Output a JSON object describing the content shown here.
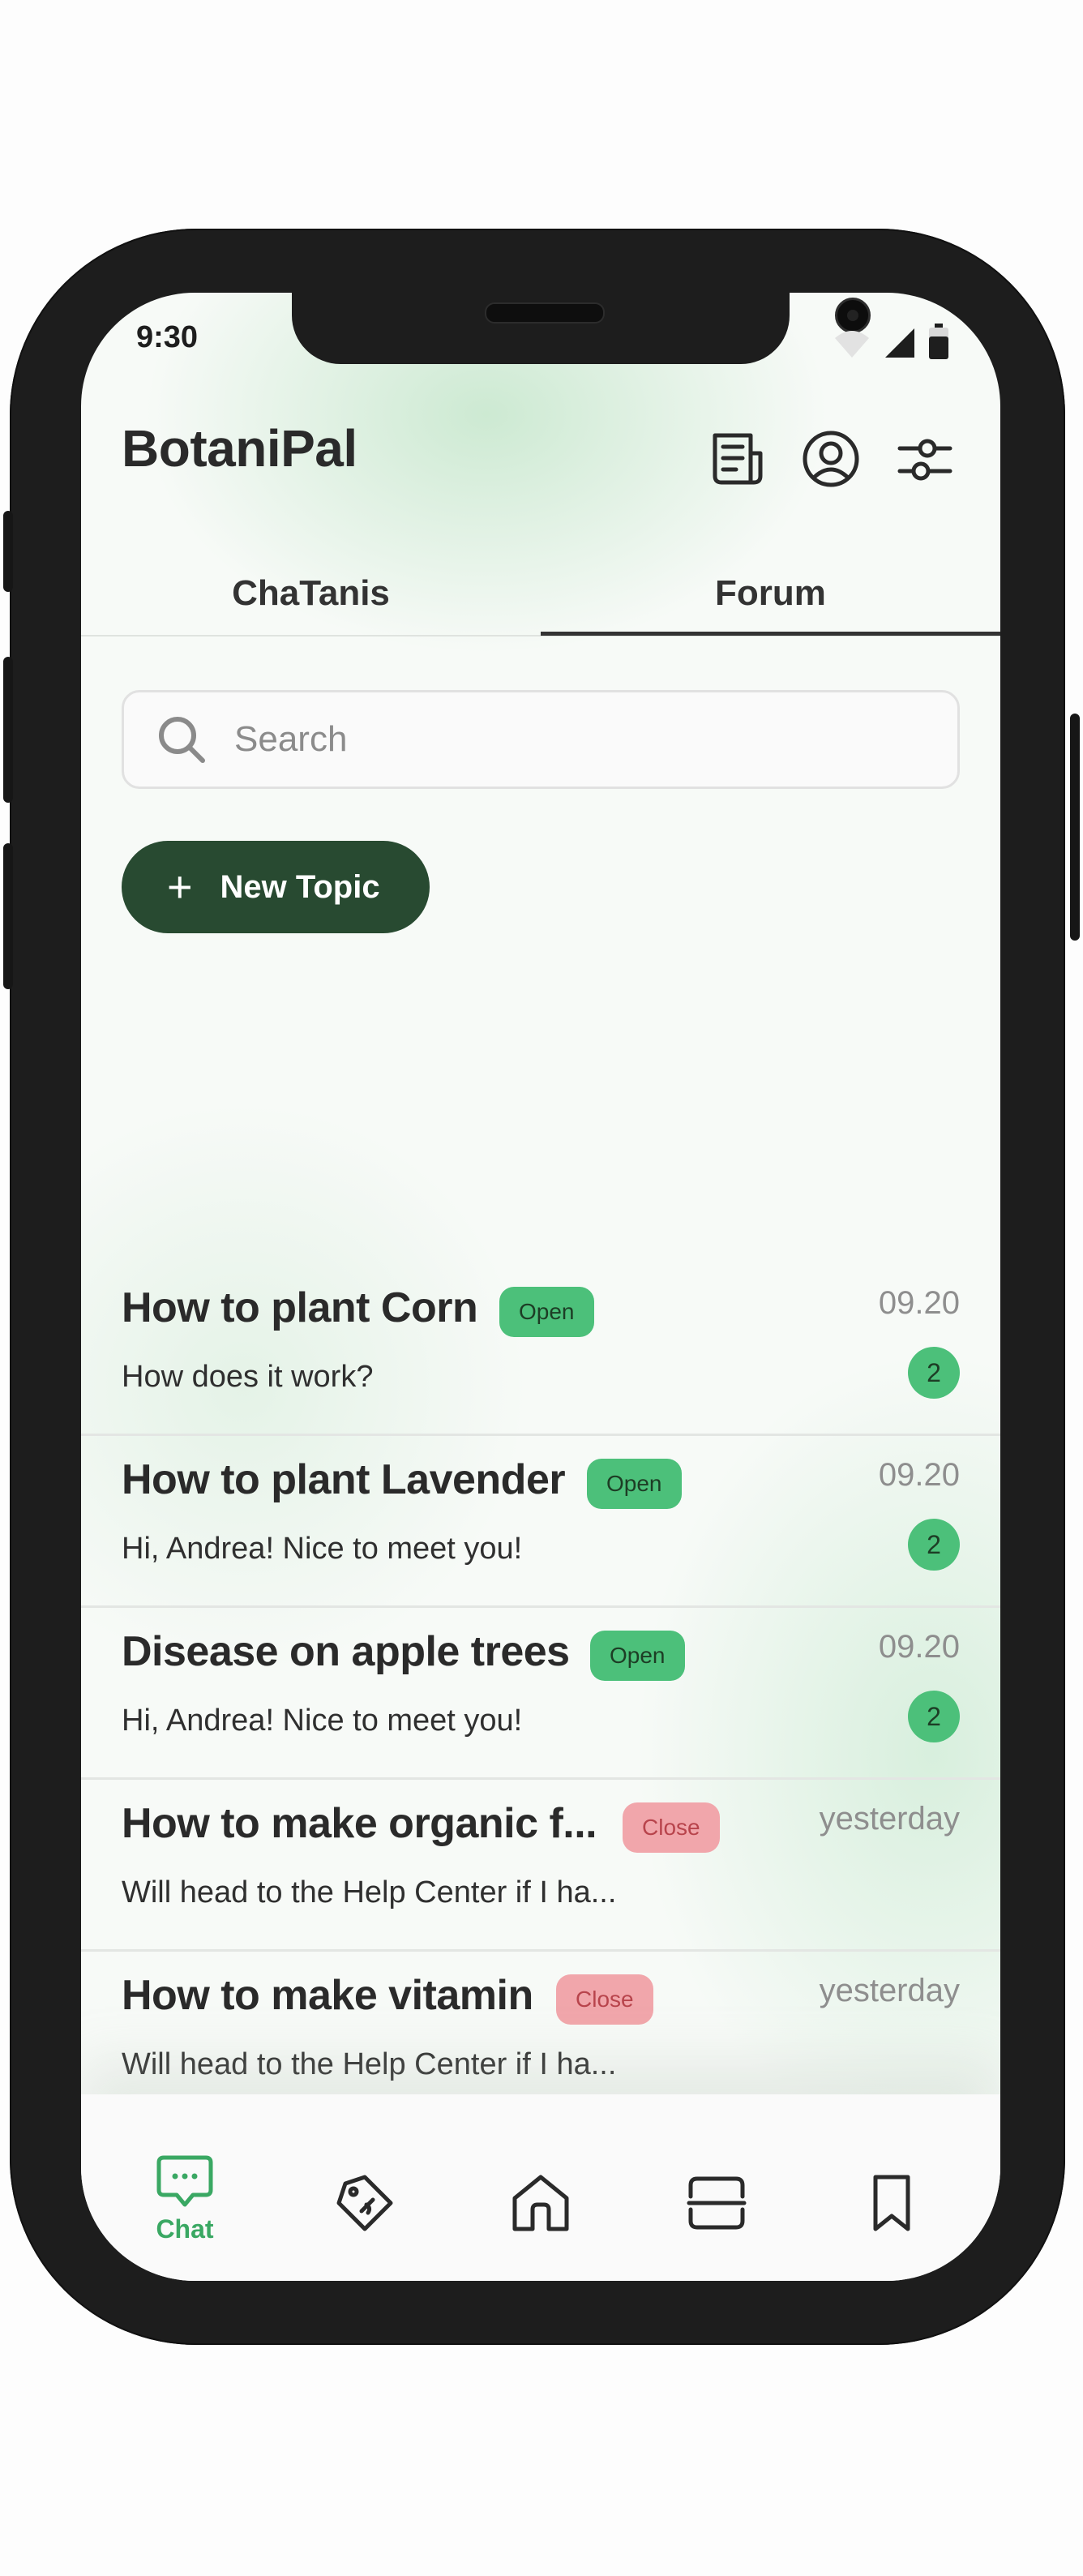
{
  "status_bar": {
    "time": "9:30"
  },
  "header": {
    "app_title": "BotaniPal"
  },
  "tabs": [
    {
      "label": "ChaTanis",
      "active": false
    },
    {
      "label": "Forum",
      "active": true
    }
  ],
  "search": {
    "placeholder": "Search"
  },
  "new_topic": {
    "label": "New Topic"
  },
  "topics": [
    {
      "title": "How to plant Corn",
      "status": "Open",
      "preview": "How does it work?",
      "date": "09.20",
      "count": "2"
    },
    {
      "title": "How to plant Lavender",
      "status": "Open",
      "preview": "Hi, Andrea! Nice to meet you!",
      "date": "09.20",
      "count": "2"
    },
    {
      "title": "Disease on apple trees",
      "status": "Open",
      "preview": "Hi, Andrea! Nice to meet you!",
      "date": "09.20",
      "count": "2"
    },
    {
      "title": "How to make organic f...",
      "status": "Close",
      "preview": "Will head to the Help Center if I ha...",
      "date": "yesterday",
      "count": null
    },
    {
      "title": "How to make vitamin",
      "status": "Close",
      "preview": "Will head to the Help Center if I ha...",
      "date": "yesterday",
      "count": null
    }
  ],
  "bottom_nav": [
    {
      "icon": "chat-bubble-icon",
      "label": "Chat",
      "active": true
    },
    {
      "icon": "tag-icon",
      "label": "",
      "active": false
    },
    {
      "icon": "home-icon",
      "label": "",
      "active": false
    },
    {
      "icon": "scan-icon",
      "label": "",
      "active": false
    },
    {
      "icon": "bookmark-icon",
      "label": "",
      "active": false
    }
  ],
  "colors": {
    "accent_green": "#4cc07a",
    "dark_green": "#284a31",
    "close_badge": "#f1a6ab",
    "nav_active": "#3aa863"
  }
}
